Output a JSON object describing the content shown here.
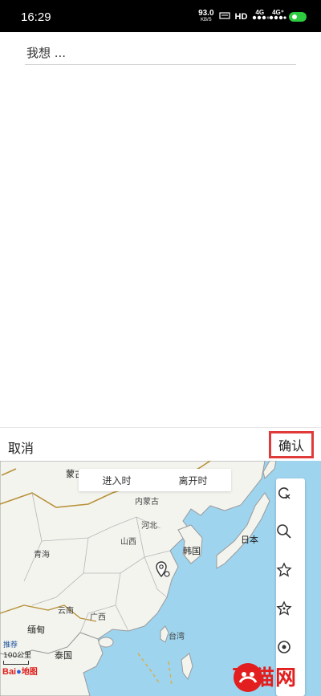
{
  "status_bar": {
    "time": "16:29",
    "speed_value": "93.0",
    "speed_unit": "KB/S",
    "hd": "HD",
    "net1": "4G",
    "net2": "4G⁺"
  },
  "search": {
    "placeholder": "我想 ..."
  },
  "actions": {
    "cancel_label": "取消",
    "confirm_label": "确认",
    "confirm_highlight_color": "#e03b3b"
  },
  "map": {
    "tabs": [
      "进入时",
      "离开时"
    ],
    "labels": {
      "mongolia": "蒙古",
      "inner_mongolia": "内蒙古",
      "korea": "韩国",
      "japan": "日本",
      "myanmar": "缅甸",
      "thailand": "泰国",
      "xinjiang_region": "青海",
      "yunnan": "云南",
      "guangxi": "广西",
      "taiwan": "台湾",
      "shanxi": "山西",
      "hebei": "河北"
    },
    "scale_text": "100公里",
    "scale_prefix": "推荐",
    "tools": [
      "refresh-location-icon",
      "search-icon",
      "star-icon",
      "star-outline-icon",
      "locate-icon"
    ],
    "sea_color": "#9ed4ee",
    "land_color": "#f4f4ef"
  },
  "logo": {
    "baidu_brand": "Bai",
    "baidu_map": "地图"
  },
  "watermark": {
    "text": "飞猫网"
  }
}
